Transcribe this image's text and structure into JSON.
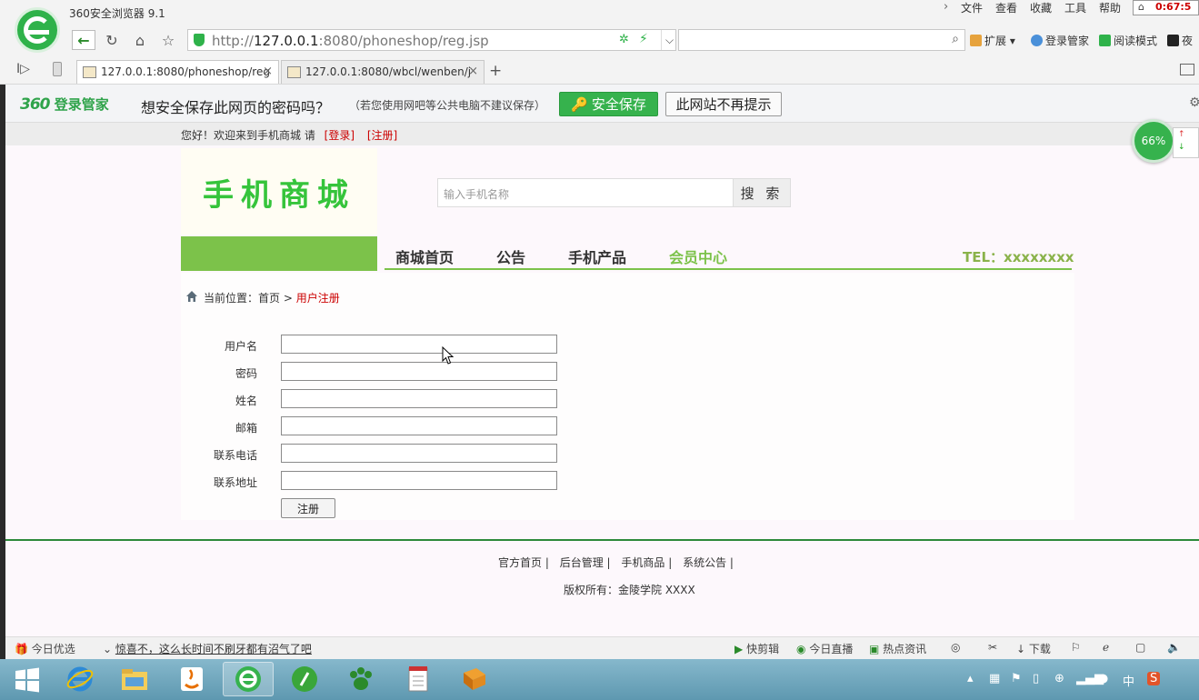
{
  "browser": {
    "title": "360安全浏览器 9.1",
    "menu": [
      "文件",
      "查看",
      "收藏",
      "工具",
      "帮助"
    ],
    "clock": "0:67:5",
    "address": {
      "scheme": "http://",
      "host": "127.0.0.1",
      "rest": ":8080/phoneshop/reg.jsp"
    },
    "toolbar": {
      "extensions": "扩展",
      "login_manager": "登录管家",
      "reading_mode": "阅读模式",
      "night": "夜"
    },
    "tabs": [
      {
        "label": "127.0.0.1:8080/phoneshop/reg"
      },
      {
        "label": "127.0.0.1:8080/wbcl/wenben/j"
      }
    ]
  },
  "password_bar": {
    "logo_num": "360",
    "logo_text": "登录管家",
    "question": "想安全保存此网页的密码吗？",
    "hint": "（若您使用网吧等公共电脑不建议保存）",
    "save_label": "安全保存",
    "never_label": "此网站不再提示"
  },
  "speed": {
    "percent": "66%"
  },
  "site": {
    "welcome": "您好！欢迎来到手机商城 请",
    "login_link": "[登录]",
    "register_link": "[注册]",
    "logo": "手机商城",
    "search_placeholder": "输入手机名称",
    "search_btn": "搜 索",
    "nav": [
      "商城首页",
      "公告",
      "手机产品",
      "会员中心"
    ],
    "active_nav": "会员中心",
    "tel": "TEL：xxxxxxxx",
    "breadcrumb": {
      "prefix": "当前位置：",
      "home": "首页",
      "sep": " > ",
      "current": "用户注册"
    },
    "form": {
      "fields": [
        "用户名",
        "密码",
        "姓名",
        "邮箱",
        "联系电话",
        "联系地址"
      ],
      "values": [
        "",
        "",
        "",
        "",
        "",
        ""
      ],
      "submit": "注册"
    },
    "footer_links": [
      "官方首页 |",
      "后台管理 |",
      "手机商品 |",
      "系统公告 |"
    ],
    "copyright": "版权所有：金陵学院 XXXX"
  },
  "status_bar": {
    "today_pick": "今日优选",
    "news": "惊喜不，这么长时间不刷牙都有沼气了吧",
    "quick_clip": "快剪辑",
    "live": "今日直播",
    "hot_news": "热点资讯",
    "download": "下载"
  },
  "taskbar": {
    "ime": "中"
  },
  "colors": {
    "brand_green": "#36b24d",
    "nav_green": "#7cc24a",
    "link_red": "#cc0000",
    "footer_green": "#2d8a3a"
  }
}
